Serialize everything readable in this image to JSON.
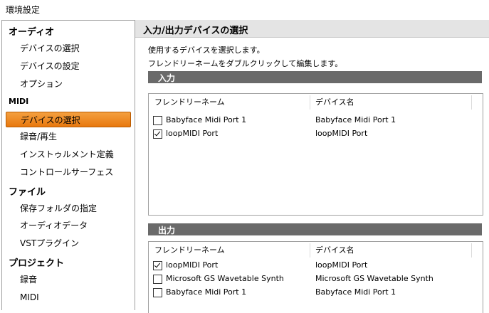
{
  "window": {
    "title": "環境設定"
  },
  "sidebar": {
    "categories": [
      {
        "label": "オーディオ",
        "items": [
          "デバイスの選択",
          "デバイスの設定",
          "オプション"
        ]
      },
      {
        "label": "MIDI",
        "items": [
          "デバイスの選択",
          "録音/再生",
          "インストゥルメント定義",
          "コントロールサーフェス"
        ]
      },
      {
        "label": "ファイル",
        "items": [
          "保存フォルダの指定",
          "オーディオデータ",
          "VSTプラグイン"
        ]
      },
      {
        "label": "プロジェクト",
        "items": [
          "録音",
          "MIDI"
        ]
      }
    ],
    "selected": "MIDI > デバイスの選択"
  },
  "panel": {
    "title": "入力/出力デバイスの選択",
    "description_1": "使用するデバイスを選択します。",
    "description_2": "フレンドリーネームをダブルクリックして編集します。",
    "input": {
      "section_label": "入力",
      "columns": [
        "フレンドリーネーム",
        "デバイス名"
      ],
      "rows": [
        {
          "friendly_name": "Babyface Midi Port 1",
          "device_name": "Babyface Midi Port 1",
          "checked": false
        },
        {
          "friendly_name": "loopMIDI Port",
          "device_name": "loopMIDI Port",
          "checked": true
        }
      ]
    },
    "output": {
      "section_label": "出力",
      "columns": [
        "フレンドリーネーム",
        "デバイス名"
      ],
      "rows": [
        {
          "friendly_name": "loopMIDI Port",
          "device_name": "loopMIDI Port",
          "checked": true
        },
        {
          "friendly_name": "Microsoft GS Wavetable Synth",
          "device_name": "Microsoft GS Wavetable Synth",
          "checked": false
        },
        {
          "friendly_name": "Babyface Midi Port 1",
          "device_name": "Babyface Midi Port 1",
          "checked": false
        }
      ]
    }
  },
  "colors": {
    "selection": "#e8780e",
    "section_bar": "#6a6a6a",
    "panel_header": "#e4e4e4"
  }
}
